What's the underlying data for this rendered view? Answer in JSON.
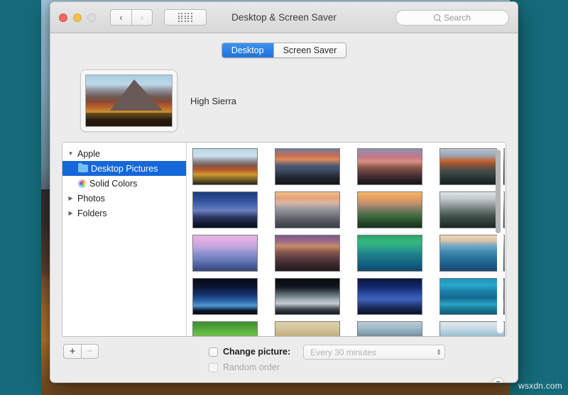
{
  "desktop": {
    "background_color": "#156b7b",
    "watermark": "wsxdn.com"
  },
  "window": {
    "title": "Desktop & Screen Saver",
    "traffic_lights": [
      {
        "name": "close",
        "color": "#ee6a5f"
      },
      {
        "name": "minimize",
        "color": "#f5bf4f"
      },
      {
        "name": "zoom",
        "color": "#dcdcdc"
      }
    ],
    "nav": {
      "back_icon": "chevron-left-icon",
      "back_label": "‹",
      "forward_icon": "chevron-right-icon",
      "forward_label": "›",
      "grid_icon": "show-all-grid-icon"
    },
    "search": {
      "icon": "search-icon",
      "placeholder": "Search",
      "value": ""
    }
  },
  "tabs": {
    "items": [
      {
        "label": "Desktop",
        "selected": true
      },
      {
        "label": "Screen Saver",
        "selected": false
      }
    ],
    "selected_color": "#1d72df"
  },
  "preview": {
    "name": "High Sierra",
    "image_alt": "high-sierra-mountain-wallpaper"
  },
  "sidebar": {
    "items": [
      {
        "label": "Apple",
        "level": 0,
        "expanded": true,
        "disclosure": "▼",
        "icon": null,
        "selected": false
      },
      {
        "label": "Desktop Pictures",
        "level": 1,
        "expanded": null,
        "disclosure": "",
        "icon": "folder-icon",
        "selected": true
      },
      {
        "label": "Solid Colors",
        "level": 1,
        "expanded": null,
        "disclosure": "",
        "icon": "color-wheel-icon",
        "selected": false
      },
      {
        "label": "Photos",
        "level": 0,
        "expanded": false,
        "disclosure": "▶",
        "icon": null,
        "selected": false
      },
      {
        "label": "Folders",
        "level": 0,
        "expanded": false,
        "disclosure": "▶",
        "icon": null,
        "selected": false
      }
    ],
    "selection_color": "#1667d8"
  },
  "thumbnails": {
    "columns": 4,
    "items": [
      {
        "name": "high-sierra",
        "css": "linear-gradient(180deg,#b7d7e8 0%,#cfe2ec 20%,#8e8f95 34%,#7d5a4e 46%,#b4552c 58%,#d2982f 72%,#7f6a27 84%,#2e2118 100%)"
      },
      {
        "name": "el-capitan-sunrise",
        "css": "linear-gradient(180deg,#6b7f9e 0%,#c86a52 18%,#d98a5c 30%,#4a5a72 48%,#3b4a60 62%,#22262f 80%,#14161b 100%)"
      },
      {
        "name": "sierra-dusk",
        "css": "linear-gradient(180deg,#8d93ad 0%,#c4788a 22%,#d98f86 36%,#8b5448 52%,#55373a 70%,#2a2024 88%,#181318 100%)"
      },
      {
        "name": "el-capitan",
        "css": "linear-gradient(180deg,#b9c2cc 0%,#9aa6b4 18%,#c4622f 34%,#7a5038 48%,#3c4a4a 66%,#23312f 84%,#16201f 100%)"
      },
      {
        "name": "yosemite-night",
        "css": "linear-gradient(180deg,#1f3a7a 0%,#2d4f96 20%,#4a6ab0 38%,#6b7fc0 52%,#2a3760 70%,#121a33 88%,#0a0f20 100%)"
      },
      {
        "name": "half-dome-sunset",
        "css": "linear-gradient(180deg,#f0c18a 0%,#e8a07a 16%,#d9b7a4 30%,#9a9aa0 46%,#7b7d85 62%,#55585f 80%,#3a3d44 100%)"
      },
      {
        "name": "yosemite-valley",
        "css": "linear-gradient(180deg,#f3b76a 0%,#e4a05f 16%,#c09070 32%,#7e7a62 48%,#3f6a3c 68%,#24472a 86%,#16301c 100%)"
      },
      {
        "name": "yosemite-bw",
        "css": "linear-gradient(180deg,#dfe3e6 0%,#c3c9cd 18%,#9aa2a6 34%,#6e7a74 50%,#41504a 68%,#2b3a33 86%,#1c2823 100%)"
      },
      {
        "name": "yosemite-pink",
        "css": "linear-gradient(180deg,#e7b9e0 0%,#d9a9e2 18%,#b9a6dd 34%,#8f8fd0 50%,#6f82bd 66%,#4d5f9c 84%,#39477c 100%)"
      },
      {
        "name": "sierra-lake",
        "css": "linear-gradient(180deg,#7c5a8c 0%,#9a6a86 16%,#c78a6a 30%,#8a5a52 46%,#5d3c3e 64%,#3a282c 82%,#24181c 100%)"
      },
      {
        "name": "mavericks-wave",
        "css": "linear-gradient(180deg,#2fa06a 0%,#35b97e 18%,#2b9f8c 36%,#1f7f8c 54%,#176a84 72%,#11587a 88%,#0d4a6c 100%)"
      },
      {
        "name": "blue-wave",
        "css": "linear-gradient(180deg,#f0d7bc 0%,#dcc3a8 14%,#6fa8c4 30%,#3f87ae 48%,#2a6f9c 66%,#1d5a86 84%,#164a72 100%)"
      },
      {
        "name": "earth-horizon",
        "css": "linear-gradient(180deg,#060a18 0%,#0a1430 22%,#15306a 44%,#2a63a8 62%,#4f9ad0 76%,#0a1630 90%,#05080f 100%)"
      },
      {
        "name": "earth-from-space",
        "css": "linear-gradient(180deg,#07090c 0%,#121820 24%,#5c6a72 44%,#9aa6ac 58%,#c6ced2 70%,#3c464c 86%,#14181c 100%)"
      },
      {
        "name": "aurora-blue",
        "css": "linear-gradient(180deg,#0b1840 0%,#13276a 22%,#2a4aa0 42%,#3f63bc 58%,#22376f 76%,#101c3e 92%,#0a1228 100%)"
      },
      {
        "name": "ice-blue-abstract",
        "css": "linear-gradient(180deg,#1f94bc 0%,#2aa8cc 18%,#1d7fa8 36%,#13698f 54%,#2ba4c4 72%,#16738f 88%,#0f5c78 100%)"
      },
      {
        "name": "green-fields",
        "css": "linear-gradient(180deg,#3f8f2f 0%,#4fa83a 18%,#6cbf4a 36%,#4f9a35 54%,#3a7c2a 72%,#2c6420 88%,#224e1a 100%)"
      },
      {
        "name": "desert-dunes",
        "css": "linear-gradient(180deg,#e0d2ae 0%,#d4c59c 18%,#c4b286 36%,#b09c6e 54%,#9c8a60 72%,#8a7a54 88%,#74664a 100%)"
      },
      {
        "name": "misty-mountains",
        "css": "linear-gradient(180deg,#b9cdd8 0%,#9fb8c8 18%,#7f9aa8 34%,#5c7280 50%,#3c4a52 68%,#222a2e 86%,#12171a 100%)"
      },
      {
        "name": "frozen-river",
        "css": "linear-gradient(180deg,#dfe9ef 0%,#c8dae6 18%,#a8c6d8 34%,#7fa8c0 52%,#5f8fae 70%,#4a7c9c 86%,#3c6c8c 100%)"
      }
    ]
  },
  "bottom": {
    "add_button": "+",
    "remove_button": "−",
    "change_picture": {
      "label": "Change picture:",
      "checked": false,
      "enabled": true
    },
    "random_order": {
      "label": "Random order",
      "checked": false,
      "enabled": false
    },
    "interval": {
      "value": "Every 30 minutes",
      "enabled": false,
      "up_glyph": "▴",
      "down_glyph": "▾"
    },
    "help_button": "?"
  }
}
